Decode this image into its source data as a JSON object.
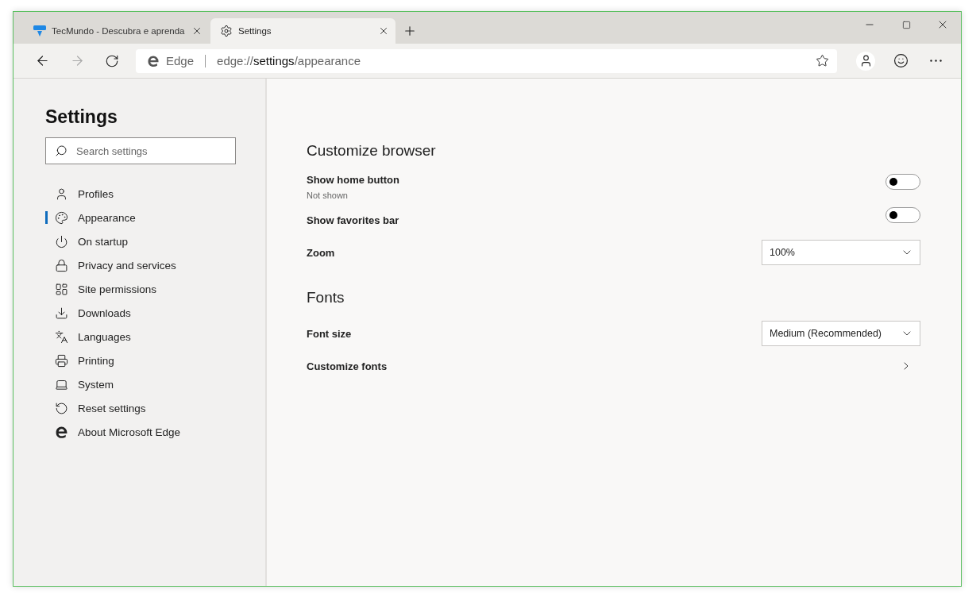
{
  "tabs": [
    {
      "title": "TecMundo - Descubra e aprenda",
      "selected": false
    },
    {
      "title": "Settings",
      "selected": true
    }
  ],
  "address": {
    "site": "Edge",
    "url_prefix": "edge://",
    "url_host": "settings",
    "url_path": "/appearance"
  },
  "sidebar": {
    "title": "Settings",
    "search": {
      "placeholder": "Search settings"
    },
    "items": [
      {
        "label": "Profiles",
        "selected": false
      },
      {
        "label": "Appearance",
        "selected": true
      },
      {
        "label": "On startup",
        "selected": false
      },
      {
        "label": "Privacy and services",
        "selected": false
      },
      {
        "label": "Site permissions",
        "selected": false
      },
      {
        "label": "Downloads",
        "selected": false
      },
      {
        "label": "Languages",
        "selected": false
      },
      {
        "label": "Printing",
        "selected": false
      },
      {
        "label": "System",
        "selected": false
      },
      {
        "label": "Reset settings",
        "selected": false
      },
      {
        "label": "About Microsoft Edge",
        "selected": false
      }
    ]
  },
  "sections": [
    {
      "title": "Customize browser",
      "rows": [
        {
          "kind": "toggle",
          "label": "Show home button",
          "description": "Not shown",
          "on": false
        },
        {
          "kind": "toggle",
          "label": "Show favorites bar",
          "on": false
        },
        {
          "kind": "select",
          "label": "Zoom",
          "value": "100%"
        }
      ]
    },
    {
      "title": "Fonts",
      "rows": [
        {
          "kind": "select",
          "label": "Font size",
          "value": "Medium (Recommended)"
        },
        {
          "kind": "link",
          "label": "Customize fonts"
        }
      ]
    }
  ]
}
